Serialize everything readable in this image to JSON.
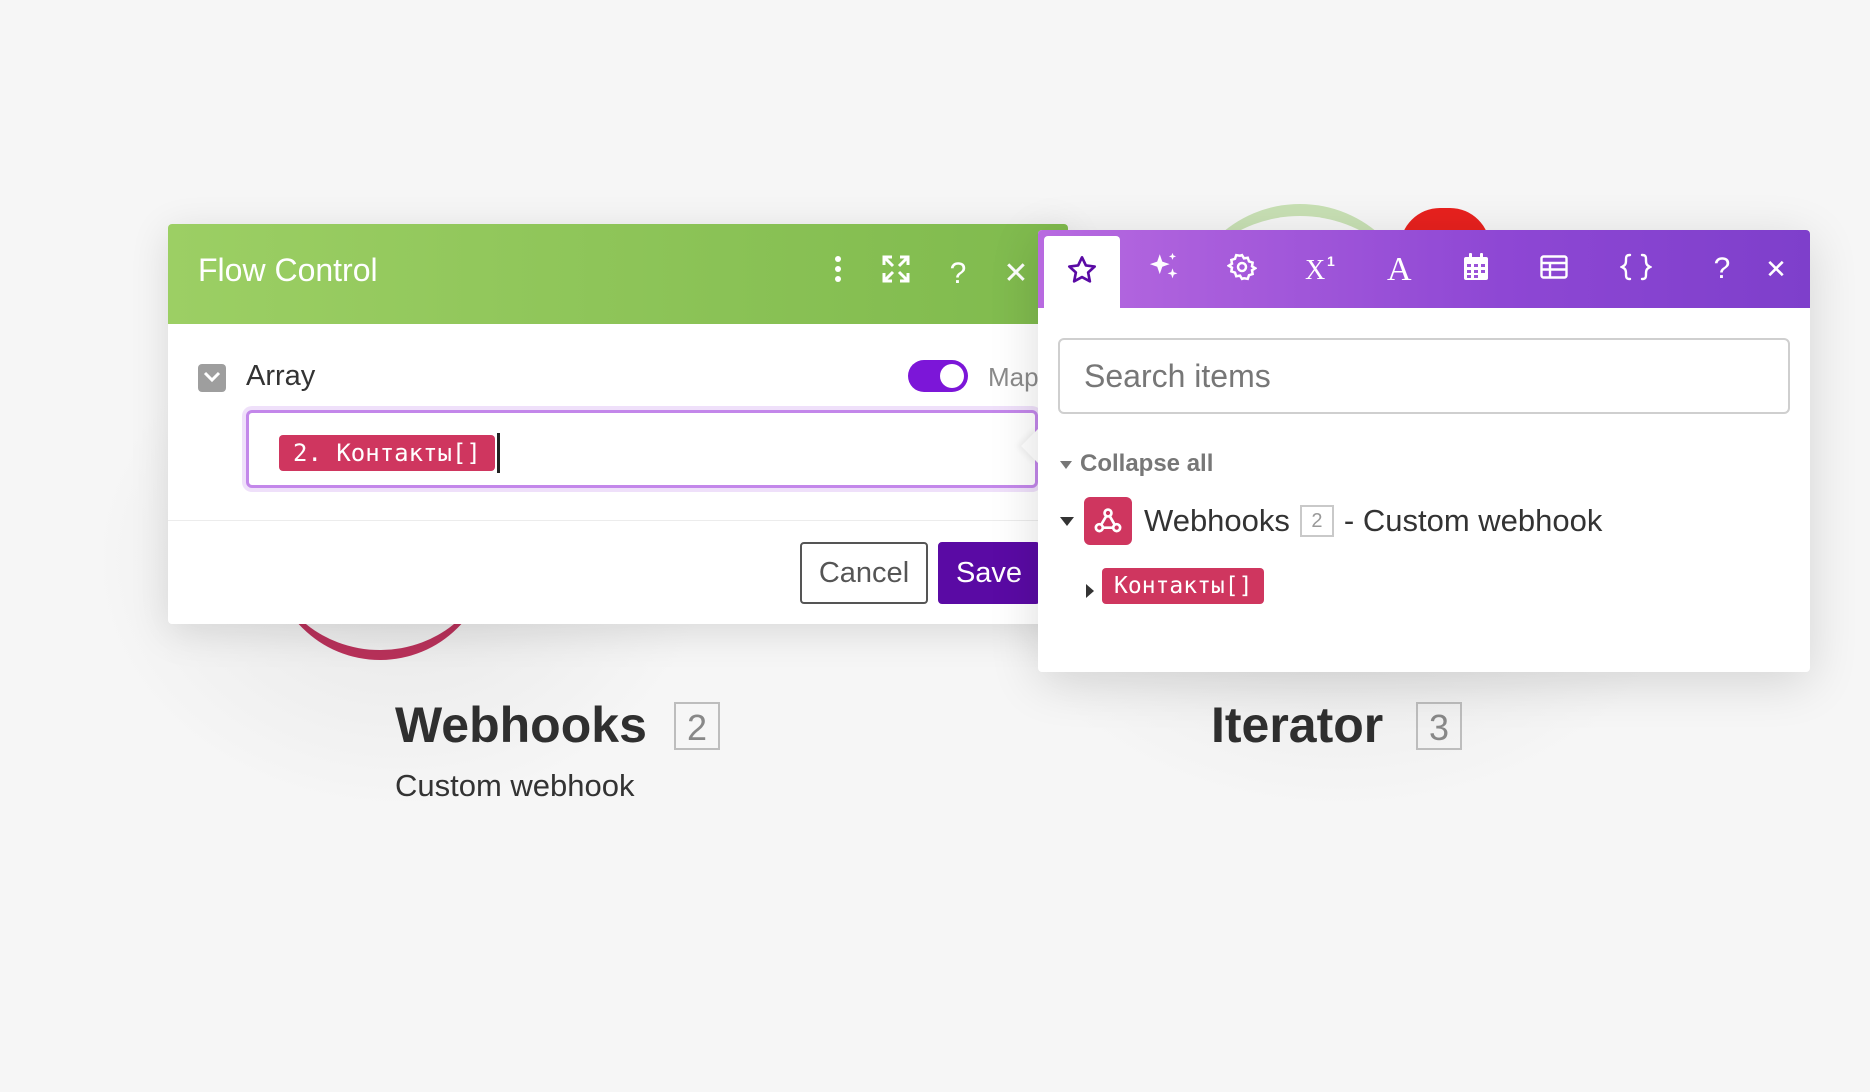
{
  "scenario": {
    "modules": [
      {
        "name": "Webhooks",
        "number": "2",
        "subtitle": "Custom webhook",
        "color": "#b8315a"
      },
      {
        "name": "Iterator",
        "number": "3",
        "color": "#c8e0b4"
      }
    ]
  },
  "dialog": {
    "title": "Flow Control",
    "header_icons": [
      "more-vertical-icon",
      "expand-icon",
      "help-icon",
      "close-icon"
    ],
    "field": {
      "label": "Array",
      "toggle_label": "Map",
      "toggle_on": true,
      "mapped_pill": "2. Контакты[]"
    },
    "cancel_label": "Cancel",
    "save_label": "Save",
    "colors": {
      "header": "#8dc35a",
      "save": "#5a0aa4",
      "toggle": "#7c16d8"
    }
  },
  "panel": {
    "tabs": [
      {
        "icon": "star-icon",
        "active": true
      },
      {
        "icon": "sparkles-icon"
      },
      {
        "icon": "gear-icon"
      },
      {
        "icon": "superscript-math-icon"
      },
      {
        "icon": "text-format-icon"
      },
      {
        "icon": "calendar-icon"
      },
      {
        "icon": "table-icon"
      },
      {
        "icon": "json-braces-icon"
      }
    ],
    "help_glyph": "?",
    "close_glyph": "✕",
    "search_placeholder": "Search items",
    "collapse_all": "Collapse all",
    "tree": {
      "app": "Webhooks",
      "number": "2",
      "description": "- Custom webhook",
      "item": "Контакты[]"
    },
    "colors": {
      "tabs": "#9a52d8",
      "pill": "#cf365f"
    }
  }
}
